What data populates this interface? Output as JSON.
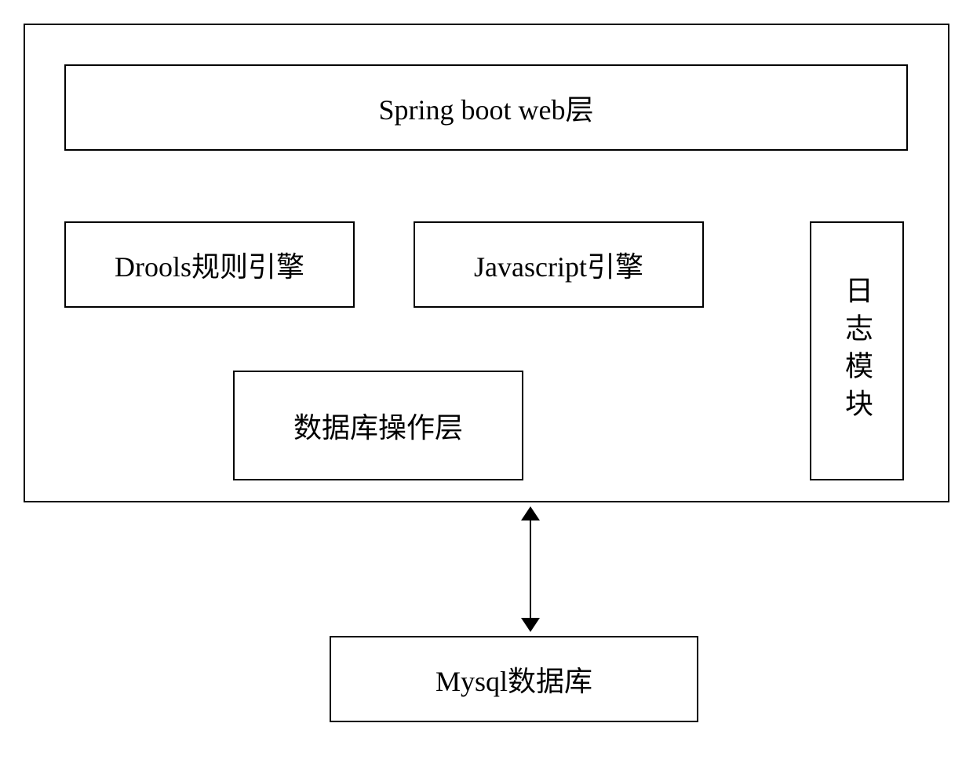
{
  "labels": {
    "webLayer": "Spring boot web层",
    "drools": "Drools规则引擎",
    "javascript": "Javascript引擎",
    "logModule": "日志模块",
    "dbLayer": "数据库操作层",
    "mysql": "Mysql数据库"
  }
}
